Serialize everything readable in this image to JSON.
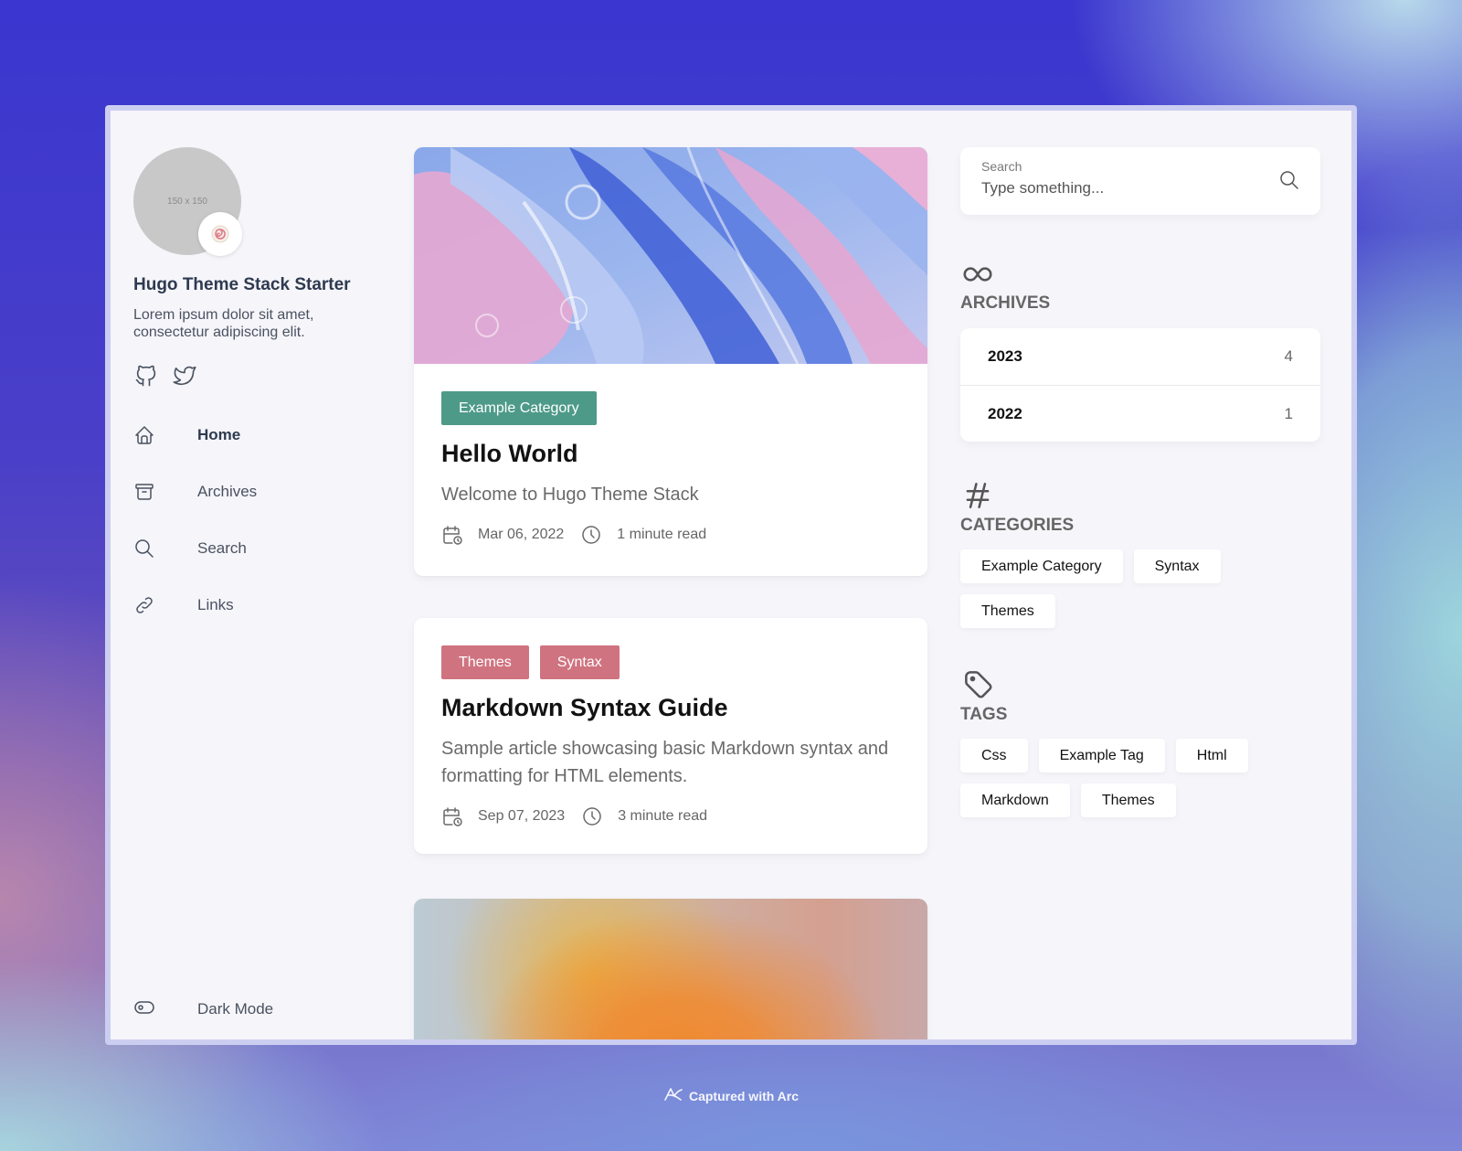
{
  "sidebar": {
    "avatar_placeholder": "150 x 150",
    "avatar_emoji": "🍥",
    "site_name": "Hugo Theme Stack Starter",
    "site_description": "Lorem ipsum dolor sit amet, consectetur adipiscing elit.",
    "social": [
      {
        "icon": "github-icon"
      },
      {
        "icon": "twitter-icon"
      }
    ],
    "nav": [
      {
        "label": "Home",
        "icon": "home-icon",
        "active": true
      },
      {
        "label": "Archives",
        "icon": "archive-box-icon",
        "active": false
      },
      {
        "label": "Search",
        "icon": "search-icon",
        "active": false
      },
      {
        "label": "Links",
        "icon": "link-icon",
        "active": false
      }
    ],
    "dark_mode_label": "Dark Mode"
  },
  "posts": [
    {
      "categories": [
        "Example Category"
      ],
      "category_color": "#4d9a89",
      "title": "Hello World",
      "subtitle": "Welcome to Hugo Theme Stack",
      "date": "Mar 06, 2022",
      "read_time": "1 minute read",
      "has_image": true
    },
    {
      "categories": [
        "Themes",
        "Syntax"
      ],
      "category_color": "#d07380",
      "title": "Markdown Syntax Guide",
      "subtitle": "Sample article showcasing basic Markdown syntax and formatting for HTML elements.",
      "date": "Sep 07, 2023",
      "read_time": "3 minute read",
      "has_image": false
    }
  ],
  "right": {
    "search": {
      "label": "Search",
      "placeholder": "Type something..."
    },
    "archives": {
      "title": "ARCHIVES",
      "items": [
        {
          "year": "2023",
          "count": "4"
        },
        {
          "year": "2022",
          "count": "1"
        }
      ]
    },
    "categories": {
      "title": "CATEGORIES",
      "items": [
        "Example Category",
        "Syntax",
        "Themes"
      ]
    },
    "tags": {
      "title": "TAGS",
      "items": [
        "Css",
        "Example Tag",
        "Html",
        "Markdown",
        "Themes"
      ]
    }
  },
  "footer": {
    "capture_text": "Captured with Arc"
  },
  "colors": {
    "accent_green": "#4d9a89",
    "accent_pink": "#d07380",
    "background": "#f5f5fa"
  }
}
